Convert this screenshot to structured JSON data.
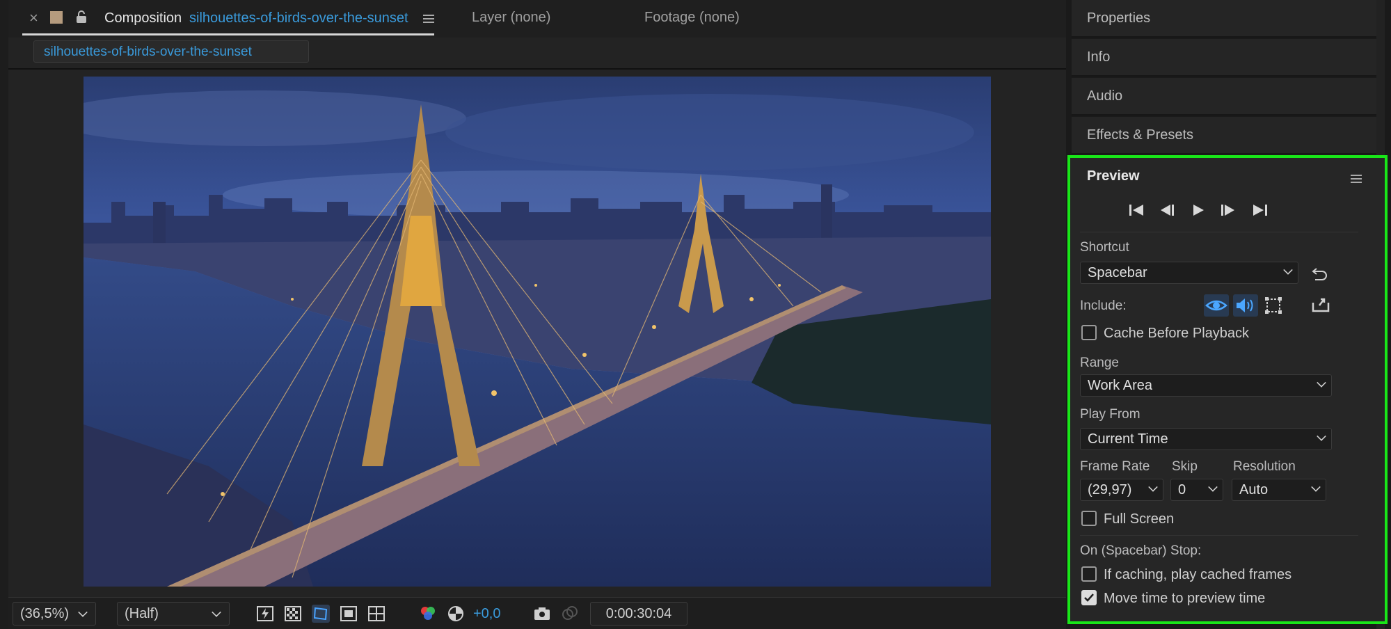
{
  "comp_panel": {
    "close_glyph": "×",
    "title_prefix": "Composition",
    "comp_name": "silhouettes-of-birds-over-the-sunset",
    "layer_tab": "Layer (none)",
    "footage_tab": "Footage (none)",
    "subtab_name": "silhouettes-of-birds-over-the-sunset"
  },
  "toolbar": {
    "zoom": "(36,5%)",
    "resolution": "(Half)",
    "exposure": "+0,0",
    "timecode": "0:00:30:04"
  },
  "side_panels": [
    "Properties",
    "Info",
    "Audio",
    "Effects & Presets"
  ],
  "preview": {
    "title": "Preview",
    "shortcut_label": "Shortcut",
    "shortcut_value": "Spacebar",
    "include_label": "Include:",
    "cache_before_playback": "Cache Before Playback",
    "range_label": "Range",
    "range_value": "Work Area",
    "play_from_label": "Play From",
    "play_from_value": "Current Time",
    "frame_rate_label": "Frame Rate",
    "frame_rate_value": "(29,97)",
    "skip_label": "Skip",
    "skip_value": "0",
    "resolution_label": "Resolution",
    "resolution_value": "Auto",
    "full_screen": "Full Screen",
    "on_stop_label": "On (Spacebar) Stop:",
    "if_caching": "If caching, play cached frames",
    "move_time": "Move time to preview time",
    "cache_checked": false,
    "full_screen_checked": false,
    "if_caching_checked": false,
    "move_time_checked": true
  },
  "colors": {
    "accent_blue": "#3a9bdc",
    "highlight_green": "#19e619"
  }
}
